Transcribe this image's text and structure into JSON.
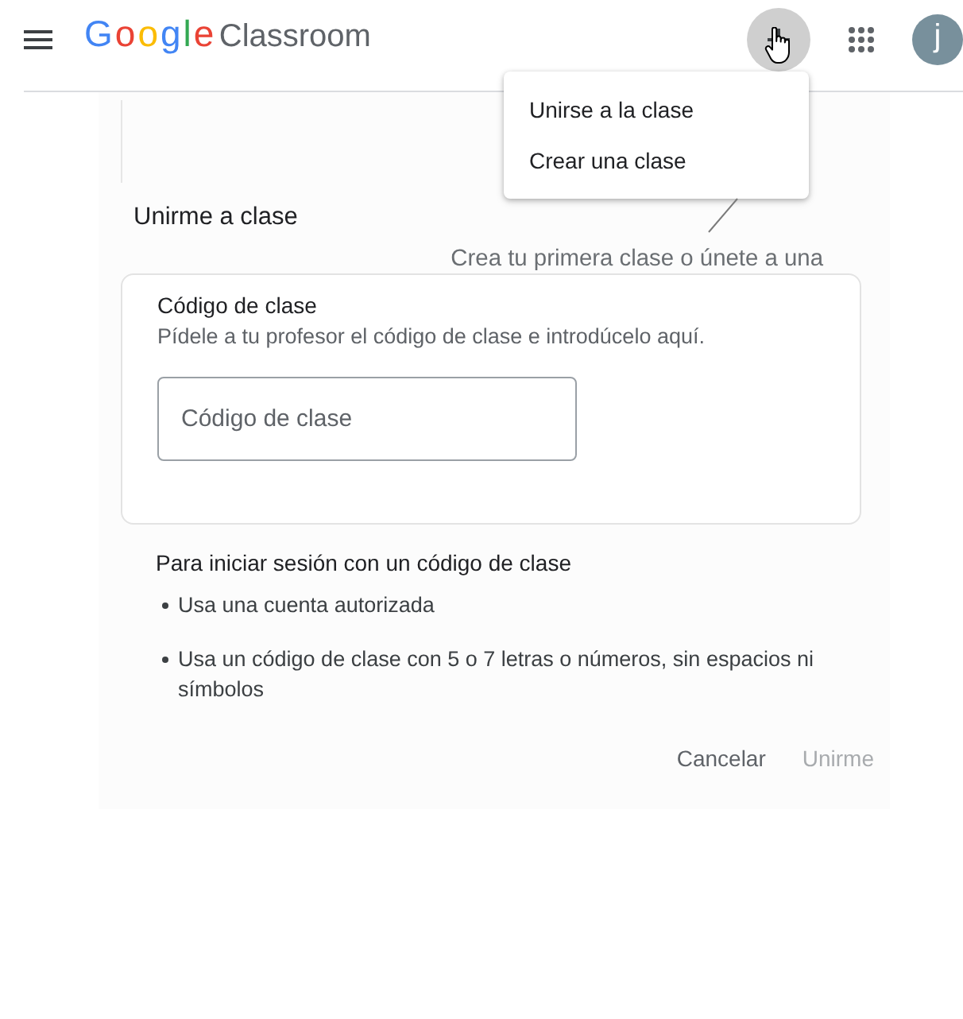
{
  "header": {
    "logo": {
      "brand": "Google",
      "product": "Classroom"
    },
    "add_button": {
      "active": true
    },
    "avatar": {
      "initial": "j"
    }
  },
  "add_menu": {
    "items": [
      {
        "label": "Unirse a la clase"
      },
      {
        "label": "Crear una clase"
      }
    ]
  },
  "join_dialog": {
    "title": "Unirme a clase",
    "callout": "Crea tu primera clase o únete a una",
    "code_section": {
      "heading": "Código de clase",
      "hint": "Pídele a tu profesor el código de clase e introdúcelo aquí.",
      "input": {
        "placeholder": "Código de clase"
      }
    },
    "tips": {
      "heading": "Para iniciar sesión con un código de clase",
      "items": [
        "Usa una cuenta autorizada",
        "Usa un código de clase con 5 o 7 letras o números, sin espacios ni símbolos"
      ]
    },
    "buttons": [
      {
        "label": "Cancelar",
        "disabled": false
      },
      {
        "label": "Unirme",
        "disabled": true
      }
    ]
  }
}
